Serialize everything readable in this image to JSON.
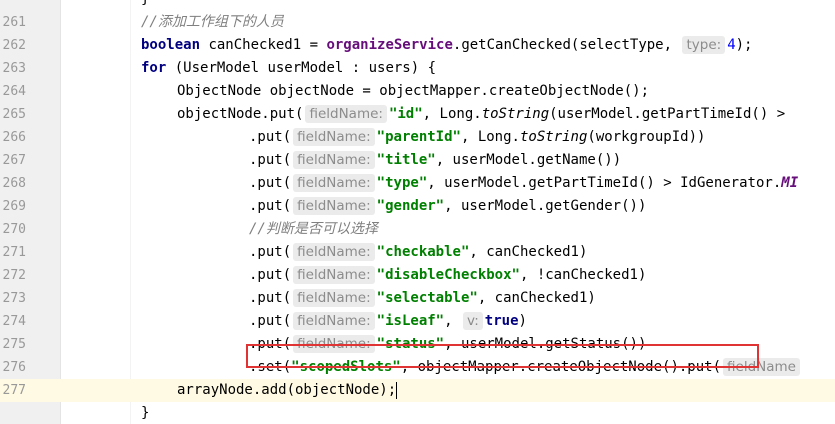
{
  "editor": {
    "lines": [
      {
        "n": "",
        "indent": 2,
        "tokens": [
          {
            "t": "}",
            "c": ""
          }
        ]
      },
      {
        "n": "261",
        "indent": 2,
        "tokens": [
          {
            "t": "//添加工作组下的人员",
            "c": "cmt"
          }
        ]
      },
      {
        "n": "262",
        "indent": 2,
        "tokens": [
          {
            "t": "boolean",
            "c": "kw"
          },
          {
            "t": " canChecked1 = ",
            "c": ""
          },
          {
            "t": "organizeService",
            "c": "field"
          },
          {
            "t": ".getCanChecked(selectType, ",
            "c": ""
          },
          {
            "t": "type:",
            "c": "hint"
          },
          {
            "t": "4",
            "c": "num"
          },
          {
            "t": ");",
            "c": ""
          }
        ]
      },
      {
        "n": "263",
        "indent": 2,
        "tokens": [
          {
            "t": "for",
            "c": "kw"
          },
          {
            "t": " (UserModel userModel : users) {",
            "c": ""
          }
        ]
      },
      {
        "n": "264",
        "indent": 3,
        "tokens": [
          {
            "t": "ObjectNode objectNode = objectMapper.createObjectNode();",
            "c": ""
          }
        ]
      },
      {
        "n": "265",
        "indent": 3,
        "tokens": [
          {
            "t": "objectNode.put(",
            "c": ""
          },
          {
            "t": "fieldName:",
            "c": "hint"
          },
          {
            "t": "\"id\"",
            "c": "str"
          },
          {
            "t": ", Long.",
            "c": ""
          },
          {
            "t": "toString",
            "c": "static-call"
          },
          {
            "t": "(userModel.getPartTimeId() > ",
            "c": ""
          }
        ]
      },
      {
        "n": "266",
        "indent": 5,
        "tokens": [
          {
            "t": ".put(",
            "c": ""
          },
          {
            "t": "fieldName:",
            "c": "hint"
          },
          {
            "t": "\"parentId\"",
            "c": "str"
          },
          {
            "t": ", Long.",
            "c": ""
          },
          {
            "t": "toString",
            "c": "static-call"
          },
          {
            "t": "(workgroupId))",
            "c": ""
          }
        ]
      },
      {
        "n": "267",
        "indent": 5,
        "tokens": [
          {
            "t": ".put(",
            "c": ""
          },
          {
            "t": "fieldName:",
            "c": "hint"
          },
          {
            "t": "\"title\"",
            "c": "str"
          },
          {
            "t": ", userModel.getName())",
            "c": ""
          }
        ]
      },
      {
        "n": "268",
        "indent": 5,
        "tokens": [
          {
            "t": ".put(",
            "c": ""
          },
          {
            "t": "fieldName:",
            "c": "hint"
          },
          {
            "t": "\"type\"",
            "c": "str"
          },
          {
            "t": ", userModel.getPartTimeId() > IdGenerator.",
            "c": ""
          },
          {
            "t": "MI",
            "c": "const"
          }
        ]
      },
      {
        "n": "269",
        "indent": 5,
        "tokens": [
          {
            "t": ".put(",
            "c": ""
          },
          {
            "t": "fieldName:",
            "c": "hint"
          },
          {
            "t": "\"gender\"",
            "c": "str"
          },
          {
            "t": ", userModel.getGender())",
            "c": ""
          }
        ]
      },
      {
        "n": "270",
        "indent": 5,
        "tokens": [
          {
            "t": "//判断是否可以选择",
            "c": "cmt"
          }
        ]
      },
      {
        "n": "271",
        "indent": 5,
        "tokens": [
          {
            "t": ".put(",
            "c": ""
          },
          {
            "t": "fieldName:",
            "c": "hint"
          },
          {
            "t": "\"checkable\"",
            "c": "str"
          },
          {
            "t": ", canChecked1)",
            "c": ""
          }
        ]
      },
      {
        "n": "272",
        "indent": 5,
        "tokens": [
          {
            "t": ".put(",
            "c": ""
          },
          {
            "t": "fieldName:",
            "c": "hint"
          },
          {
            "t": "\"disableCheckbox\"",
            "c": "str"
          },
          {
            "t": ", !canChecked1)",
            "c": ""
          }
        ]
      },
      {
        "n": "273",
        "indent": 5,
        "tokens": [
          {
            "t": ".put(",
            "c": ""
          },
          {
            "t": "fieldName:",
            "c": "hint"
          },
          {
            "t": "\"selectable\"",
            "c": "str"
          },
          {
            "t": ", canChecked1)",
            "c": ""
          }
        ]
      },
      {
        "n": "274",
        "indent": 5,
        "tokens": [
          {
            "t": ".put(",
            "c": ""
          },
          {
            "t": "fieldName:",
            "c": "hint"
          },
          {
            "t": "\"isLeaf\"",
            "c": "str"
          },
          {
            "t": ", ",
            "c": ""
          },
          {
            "t": "v:",
            "c": "hint"
          },
          {
            "t": "true",
            "c": "kw"
          },
          {
            "t": ")",
            "c": ""
          }
        ]
      },
      {
        "n": "275",
        "indent": 5,
        "tokens": [
          {
            "t": ".put(",
            "c": ""
          },
          {
            "t": "fieldName:",
            "c": "hint"
          },
          {
            "t": "\"status\"",
            "c": "str"
          },
          {
            "t": ", userModel.getStatus())",
            "c": ""
          }
        ]
      },
      {
        "n": "276",
        "indent": 5,
        "tokens": [
          {
            "t": ".set(",
            "c": ""
          },
          {
            "t": "\"scopedSlots\"",
            "c": "str"
          },
          {
            "t": ", objectMapper.createObjectNode().put(",
            "c": ""
          },
          {
            "t": "fieldName",
            "c": "hint"
          }
        ]
      },
      {
        "n": "277",
        "indent": 3,
        "current": true,
        "tokens": [
          {
            "t": "arrayNode.add(objectNode);",
            "c": ""
          },
          {
            "t": "",
            "c": "cursor"
          }
        ]
      },
      {
        "n": "",
        "indent": 2,
        "tokens": [
          {
            "t": "}",
            "c": ""
          }
        ]
      }
    ]
  }
}
